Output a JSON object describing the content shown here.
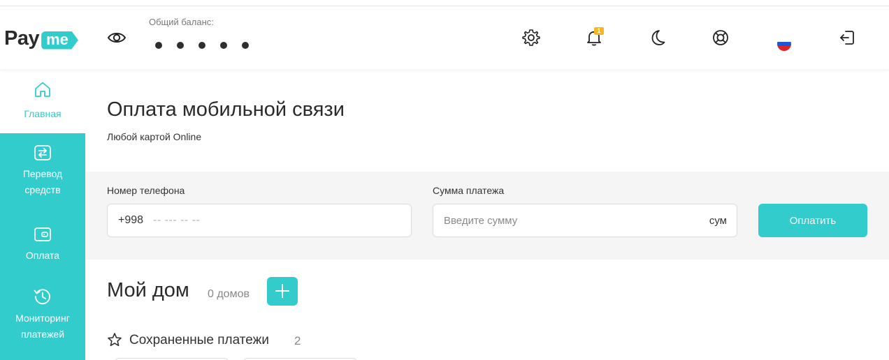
{
  "header": {
    "logo_pay": "Pay",
    "logo_me": "me",
    "balance_label": "Общий баланс:",
    "balance_hidden_dots": 5,
    "notification_count": "1",
    "icons": [
      "eye-icon",
      "gear-icon",
      "bell-icon",
      "moon-icon",
      "lifebuoy-icon",
      "flag-ru-icon",
      "logout-icon"
    ]
  },
  "sidebar": {
    "items": [
      {
        "label": "Главная",
        "icon": "home-icon"
      },
      {
        "label": "Перевод\nсредств",
        "icon": "transfer-icon"
      },
      {
        "label": "Оплата",
        "icon": "wallet-icon"
      },
      {
        "label": "Мониторинг\nплатежей",
        "icon": "history-icon"
      }
    ]
  },
  "main": {
    "title": "Оплата мобильной связи",
    "subtitle": "Любой картой Online",
    "phone_label": "Номер телефона",
    "phone_prefix": "+998",
    "phone_placeholder": "-- --- -- --",
    "sum_label": "Сумма платежа",
    "sum_placeholder": "Введите сумму",
    "sum_unit": "сум",
    "pay_button": "Оплатить",
    "home_title": "Мой дом",
    "home_count": "0 домов",
    "saved_title": "Сохраненные платежи",
    "saved_count": "2"
  },
  "colors": {
    "accent": "#33cccc",
    "badge": "#f6b820"
  }
}
